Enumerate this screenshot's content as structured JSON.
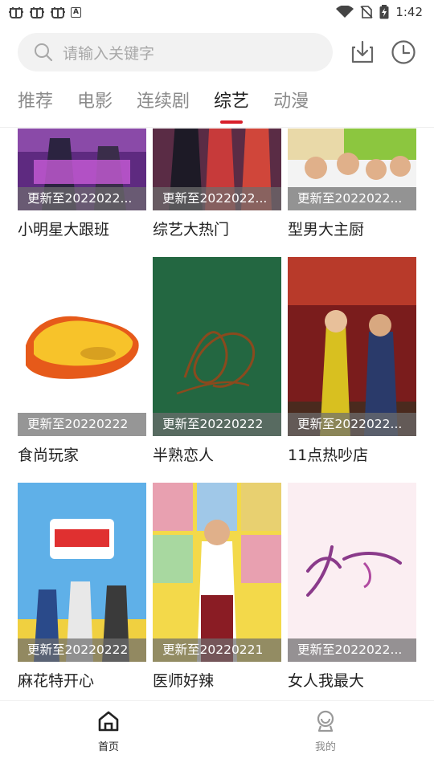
{
  "status_bar": {
    "time": "1:42",
    "left_icons": [
      "bug-icon",
      "bug-icon",
      "bug-icon",
      "a-icon"
    ],
    "right_icons": [
      "wifi-icon",
      "no-sim-icon",
      "battery-icon"
    ]
  },
  "search": {
    "placeholder": "请输入关键字"
  },
  "header_icons": [
    "download-icon",
    "history-icon"
  ],
  "tabs": [
    {
      "label": "推荐",
      "active": false
    },
    {
      "label": "电影",
      "active": false
    },
    {
      "label": "连续剧",
      "active": false
    },
    {
      "label": "综艺",
      "active": true
    },
    {
      "label": "动漫",
      "active": false
    }
  ],
  "colors": {
    "accent": "#d81e2a",
    "tab_inactive": "#8a8a8a",
    "search_bg": "#f2f2f2"
  },
  "shows": [
    {
      "title": "小明星大跟班",
      "update": "更新至2022022..."
    },
    {
      "title": "综艺大热门",
      "update": "更新至2022022..."
    },
    {
      "title": "型男大主厨",
      "update": "更新至2022022..."
    },
    {
      "title": "食尚玩家",
      "update": "更新至20220222"
    },
    {
      "title": "半熟恋人",
      "update": "更新至20220222"
    },
    {
      "title": "11点热吵店",
      "update": "更新至2022022..."
    },
    {
      "title": "麻花特开心",
      "update": "更新至20220222"
    },
    {
      "title": "医师好辣",
      "update": "更新至20220221"
    },
    {
      "title": "女人我最大",
      "update": "更新至2022022..."
    }
  ],
  "bottom_nav": [
    {
      "label": "首页",
      "icon": "home-icon",
      "active": true
    },
    {
      "label": "我的",
      "icon": "user-icon",
      "active": false
    }
  ]
}
